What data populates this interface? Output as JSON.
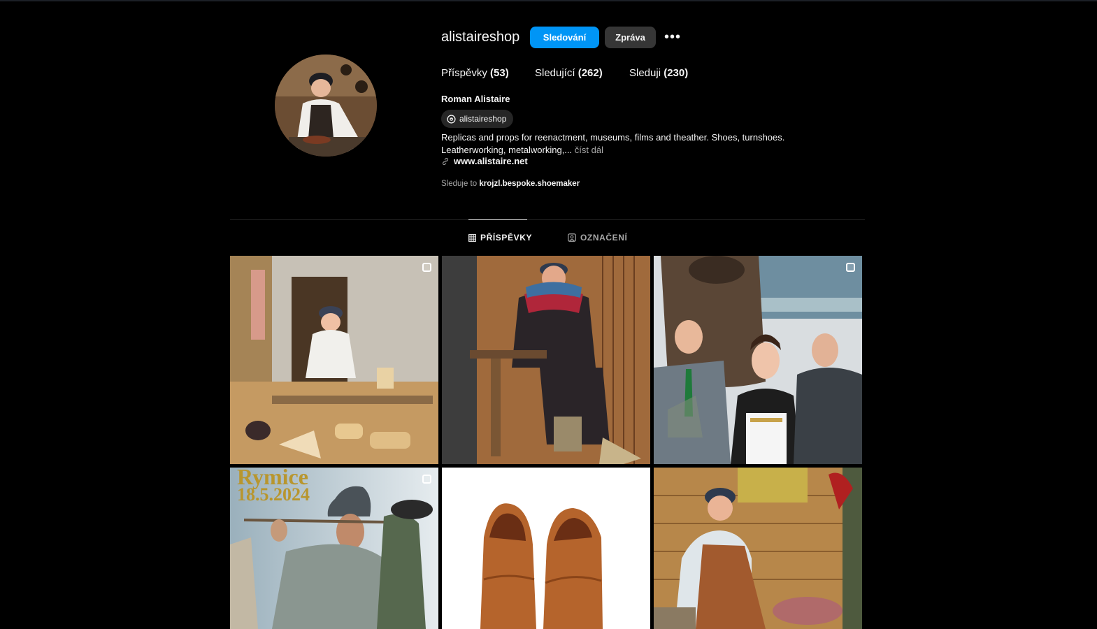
{
  "profile": {
    "username": "alistaireshop",
    "follow_label": "Sledování",
    "message_label": "Zpráva",
    "more_label": "•••",
    "stats": {
      "posts_label": "Příspěvky",
      "posts_count": "(53)",
      "followers_label": "Sledující",
      "followers_count": "(262)",
      "following_label": "Sleduji",
      "following_count": "(230)"
    },
    "full_name": "Roman Alistaire",
    "threads_handle": "alistaireshop",
    "bio_line1": "Replicas and props for reenactment, museums, films and theather. Shoes, turnshoes.",
    "bio_line2": "Leatherworking, metalworking,...",
    "bio_more": "číst dál",
    "website": "www.alistaire.net",
    "followed_by_prefix": "Sleduje to",
    "followed_by_user": "krojzl.bespoke.shoemaker"
  },
  "tabs": {
    "posts": "PŘÍSPĚVKY",
    "tagged": "OZNAČENÍ"
  },
  "grid": {
    "rymice_title": "Rymice",
    "rymice_date": "18.5.2024"
  },
  "icons": [
    "threads-icon",
    "link-icon",
    "grid-icon",
    "tagged-icon",
    "multiple-posts-icon"
  ]
}
